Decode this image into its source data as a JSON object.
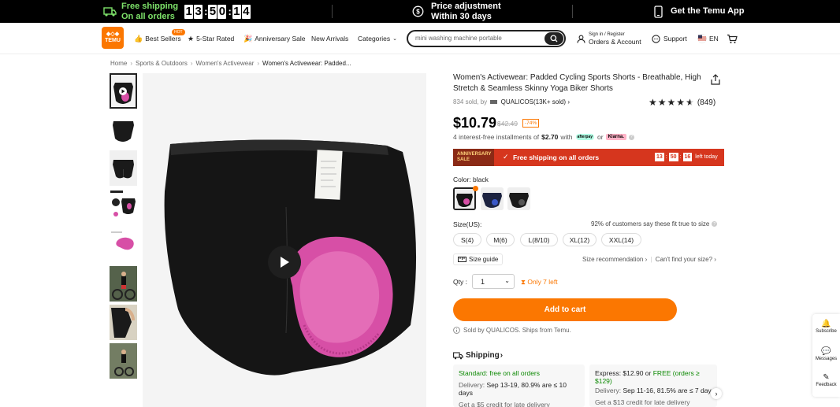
{
  "topbar": {
    "free_shipping_title": "Free shipping",
    "free_shipping_sub": "On all orders",
    "timer_digits": [
      "1",
      "3",
      "5",
      "0",
      "1",
      "4"
    ],
    "price_adj_title": "Price adjustment",
    "price_adj_sub": "Within 30 days",
    "app_label": "Get the Temu App"
  },
  "header": {
    "logo_text": "TEMU",
    "hot_badge": "HOT",
    "nav": {
      "best_sellers": "Best Sellers",
      "five_star": "5-Star Rated",
      "anniversary": "Anniversary Sale",
      "new_arrivals": "New Arrivals",
      "categories": "Categories"
    },
    "search_placeholder": "mini washing machine portable",
    "account_small": "Sign in / Register",
    "account_big": "Orders & Account",
    "support": "Support",
    "lang": "EN"
  },
  "breadcrumb": [
    "Home",
    "Sports & Outdoors",
    "Women's Activewear",
    "Women's Activewear: Padded..."
  ],
  "product": {
    "title": "Women's Activewear: Padded Cycling Sports Shorts - Breathable, High Stretch & Seamless Skinny Yoga Biker Shorts",
    "sold": "834 sold, by",
    "store": "QUALICOS(13K+ sold)",
    "rating_stars": 4.5,
    "review_count": "(849)",
    "price": "$10.79",
    "old_price": "$42.49",
    "discount": "-74%",
    "install_prefix": "4 interest-free installments of",
    "install_amount": "$2.70",
    "install_with": "with",
    "afterpay": "afterpay",
    "or": "or",
    "klarna": "Klarna.",
    "banner_anniv": "ANNIVERSARY SALE",
    "banner_ship": "Free shipping on all orders",
    "banner_timer": [
      "13",
      "50",
      "16"
    ],
    "banner_left": "left today",
    "color_label": "Color: black",
    "size_label": "Size(US):",
    "fit_text": "92% of customers say these fit true to size",
    "sizes": [
      "S(4)",
      "M(6)",
      "L(8/10)",
      "XL(12)",
      "XXL(14)"
    ],
    "size_guide": "Size guide",
    "size_rec": "Size recommendation",
    "cant_find": "Can't find your size?",
    "qty_label": "Qty :",
    "qty_value": "1",
    "only_left": "Only 7 left",
    "add_to_cart": "Add to cart",
    "sold_by": "Sold by QUALICOS. Ships from Temu.",
    "shipping_label": "Shipping"
  },
  "shipping": {
    "standard_title": "Standard: free on all orders",
    "standard_delivery_label": "Delivery:",
    "standard_delivery": "Sep 13-19, 80.9% are ≤ 10 days",
    "standard_credit": "Get a $5 credit for late delivery",
    "express_prefix": "Express: $12.90 or",
    "express_free": "FREE (orders ≥ $129)",
    "express_delivery_label": "Delivery:",
    "express_delivery": "Sep 11-16, 81.5% are ≤ 7 day",
    "express_credit": "Get a $13 credit for late delivery"
  },
  "sidebar": {
    "subscribe": "Subscribe",
    "messages": "Messages",
    "feedback": "Feedback"
  },
  "colors": {
    "brand_orange": "#fb7701",
    "banner_red": "#d6361e",
    "free_green": "#7ee26a",
    "pad_pink": "#d74fa6"
  },
  "icons": [
    "truck-icon",
    "dollar-icon",
    "phone-icon",
    "thumbs-up-icon",
    "star-badge-icon",
    "party-icon",
    "chevron-down-icon",
    "search-icon",
    "user-icon",
    "support-icon",
    "flag-icon",
    "cart-icon",
    "share-icon",
    "play-icon",
    "check-icon",
    "info-icon",
    "ruler-icon",
    "hourglass-icon",
    "truck-small-icon",
    "bell-icon",
    "message-icon",
    "feedback-icon"
  ]
}
